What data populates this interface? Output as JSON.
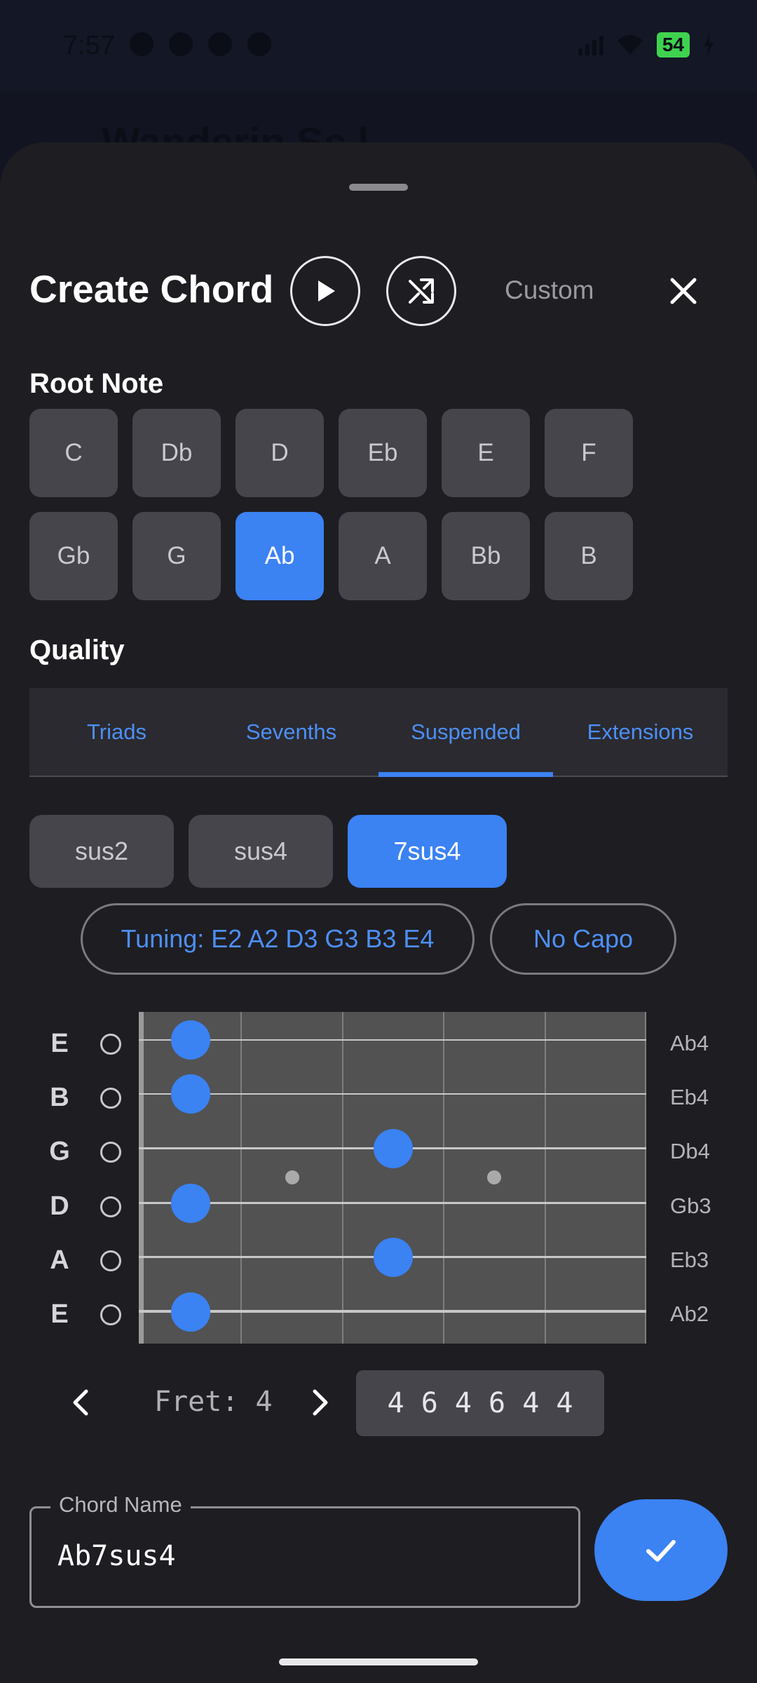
{
  "status": {
    "time": "7:57",
    "battery": "54"
  },
  "behind_title": "Wanderin  Sc l",
  "header": {
    "title": "Create Chord",
    "custom_label": "Custom"
  },
  "root": {
    "label": "Root Note",
    "notes": [
      "C",
      "Db",
      "D",
      "Eb",
      "E",
      "F",
      "Gb",
      "G",
      "Ab",
      "A",
      "Bb",
      "B"
    ],
    "selected": "Ab"
  },
  "quality": {
    "label": "Quality",
    "tabs": [
      "Triads",
      "Sevenths",
      "Suspended",
      "Extensions"
    ],
    "active_tab": "Suspended",
    "options": [
      "sus2",
      "sus4",
      "7sus4"
    ],
    "selected": "7sus4"
  },
  "tuning": {
    "label": "Tuning: E2 A2 D3 G3 B3 E4",
    "capo": "No Capo"
  },
  "fretboard": {
    "strings": [
      {
        "name": "E",
        "note": "Ab4"
      },
      {
        "name": "B",
        "note": "Eb4"
      },
      {
        "name": "G",
        "note": "Db4"
      },
      {
        "name": "D",
        "note": "Gb3"
      },
      {
        "name": "A",
        "note": "Eb3"
      },
      {
        "name": "E",
        "note": "Ab2"
      }
    ],
    "fret_label": "Fret: 4",
    "fingering": "4 6 4 6 4 4"
  },
  "chord_name": {
    "label": "Chord Name",
    "value": "Ab7sus4"
  },
  "colors": {
    "accent": "#3b82f3",
    "sheet": "#1e1d22",
    "fretboard": "#525252"
  }
}
